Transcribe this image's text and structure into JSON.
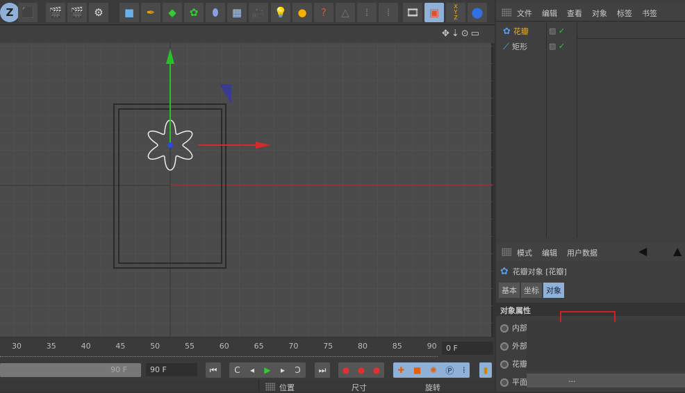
{
  "toolbar": {
    "icons": [
      "undo-z-icon",
      "coordinate-system-icon",
      "render-view-icon",
      "render-picture-viewer-icon",
      "render-settings-icon",
      "cube-icon",
      "pen-spline-icon",
      "subdivision-icon",
      "flower-array-icon",
      "deformer-icon",
      "floor-icon",
      "camera-icon",
      "light-icon",
      "material-icon",
      "help-icon",
      "snap-icon",
      "grid-icon",
      "grid2-icon",
      "clapper-icon",
      "folder-icon",
      "xyz-icon",
      "python-icon"
    ],
    "xyz_labels": [
      "X",
      "Y",
      "Z"
    ]
  },
  "object_manager": {
    "menu": [
      "文件",
      "编辑",
      "查看",
      "对象",
      "标签",
      "书签"
    ],
    "objects": [
      {
        "name": "花瓣",
        "selected": true
      },
      {
        "name": "矩形",
        "selected": false
      }
    ]
  },
  "attributes": {
    "menu": [
      "模式",
      "编辑",
      "用户数据"
    ],
    "title": "花瓣对象 [花瓣]",
    "tabs": [
      "基本",
      "坐标",
      "对象"
    ],
    "active_tab": "对象",
    "section": "对象属性",
    "rows": [
      "内部",
      "外部",
      "花瓣",
      "平面"
    ],
    "ellipsis": "..."
  },
  "timeline": {
    "ticks": [
      "30",
      "35",
      "40",
      "45",
      "50",
      "55",
      "60",
      "65",
      "70",
      "75",
      "80",
      "85",
      "90"
    ],
    "current_frame": "0 F",
    "slider_end": "90 F",
    "end_frame": "90 F"
  },
  "coords": {
    "labels": [
      "位置",
      "尺寸",
      "旋转"
    ]
  },
  "colors": {
    "accent_select": "#8fb1d8",
    "x_axis": "#d42a2a",
    "y_axis": "#2ab52a",
    "highlight_box": "#d02020"
  }
}
